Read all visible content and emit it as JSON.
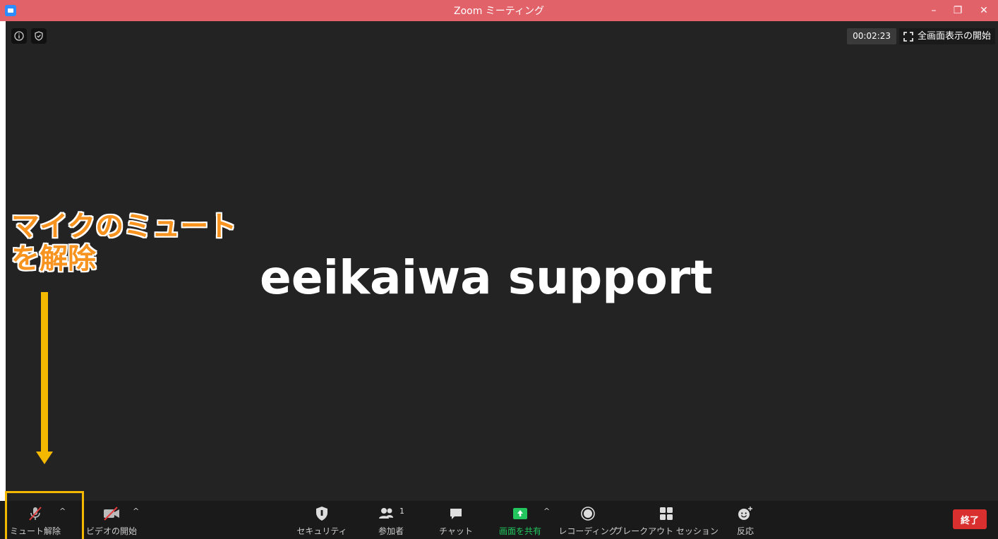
{
  "window": {
    "title": "Zoom ミーティング",
    "minimize": "–",
    "restore": "❐",
    "close": "✕"
  },
  "top_bar": {
    "timer": "00:02:23",
    "fullscreen_label": "全画面表示の開始"
  },
  "stage": {
    "name_text": "eeikaiwa support"
  },
  "annotation": {
    "line1": "マイクのミュート",
    "line2": "を解除"
  },
  "toolbar": {
    "unmute": "ミュート解除",
    "start_video": "ビデオの開始",
    "security": "セキュリティ",
    "participants": "参加者",
    "participants_count": "1",
    "chat": "チャット",
    "share_screen": "画面を共有",
    "recording": "レコーディング",
    "breakout": "ブレークアウト セッション",
    "reactions": "反応",
    "end": "終了"
  },
  "colors": {
    "title_bar": "#e2626a",
    "stage_bg": "#232323",
    "toolbar_bg": "#1a1a1a",
    "share_green": "#23c55e",
    "end_red": "#d9302f",
    "annotation_orange": "#f7931e",
    "highlight_yellow": "#f5b800"
  }
}
